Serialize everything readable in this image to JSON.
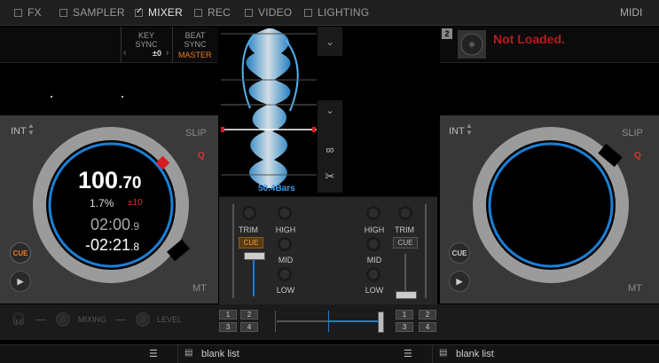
{
  "topbar": {
    "items": [
      {
        "label": "FX",
        "checked": false
      },
      {
        "label": "SAMPLER",
        "checked": false
      },
      {
        "label": "MIXER",
        "checked": true
      },
      {
        "label": "REC",
        "checked": false
      },
      {
        "label": "VIDEO",
        "checked": false
      },
      {
        "label": "LIGHTING",
        "checked": false
      }
    ],
    "midi_label": "MIDI"
  },
  "deck_left": {
    "key_sync_label": "KEY\nSYNC",
    "key_value": "±0",
    "beat_sync_label": "BEAT\nSYNC",
    "master_label": "MASTER",
    "int_label": "INT",
    "slip_label": "SLIP",
    "q_label": "Q",
    "mt_label": "MT",
    "bpm_int": "100",
    "bpm_dec": ".70",
    "pitch_percent": "1.7%",
    "pitch_range": "±10",
    "elapsed_main": "02:00",
    "elapsed_dec": ".9",
    "remaining_main": "-02:21",
    "remaining_dec": ".8",
    "cue_label": "CUE"
  },
  "deck_right": {
    "deck_number": "2",
    "status": "Not Loaded.",
    "int_label": "INT",
    "slip_label": "SLIP",
    "q_label": "Q",
    "mt_label": "MT",
    "cue_label": "CUE"
  },
  "center": {
    "bars_label": "50.4Bars"
  },
  "mixer": {
    "trim_label": "TRIM",
    "high_label": "HIGH",
    "mid_label": "MID",
    "low_label": "LOW",
    "cue_label": "CUE"
  },
  "bottom": {
    "mixing_label": "MIXING",
    "level_label": "LEVEL",
    "fx_buttons": [
      "1",
      "2",
      "3",
      "4"
    ]
  },
  "footer": {
    "left_list": "blank list",
    "right_list": "blank list"
  },
  "colors": {
    "accent_blue": "#1a7fd4",
    "master_orange": "#f07a1e",
    "not_loaded_red": "#c0181b"
  }
}
